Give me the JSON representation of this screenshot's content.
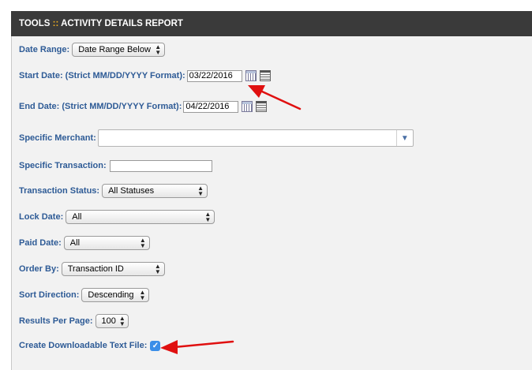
{
  "header": {
    "tools": "TOOLS",
    "sep": "::",
    "title": "ACTIVITY DETAILS REPORT"
  },
  "form": {
    "date_range": {
      "label": "Date Range:",
      "value": "Date Range Below"
    },
    "start_date": {
      "label": "Start Date: (Strict MM/DD/YYYY Format):",
      "value": "03/22/2016"
    },
    "end_date": {
      "label": "End Date: (Strict MM/DD/YYYY Format):",
      "value": "04/22/2016"
    },
    "specific_merchant": {
      "label": "Specific Merchant:",
      "value": ""
    },
    "specific_transaction": {
      "label": "Specific Transaction:",
      "value": ""
    },
    "transaction_status": {
      "label": "Transaction Status:",
      "value": "All Statuses"
    },
    "lock_date": {
      "label": "Lock Date:",
      "value": "All"
    },
    "paid_date": {
      "label": "Paid Date:",
      "value": "All"
    },
    "order_by": {
      "label": "Order By:",
      "value": "Transaction ID"
    },
    "sort_direction": {
      "label": "Sort Direction:",
      "value": "Descending"
    },
    "results_per_page": {
      "label": "Results Per Page:",
      "value": "100"
    },
    "downloadable": {
      "label": "Create Downloadable Text File:",
      "checked": true
    }
  },
  "colors": {
    "header_bg": "#3a3a3a",
    "label": "#2e5b96",
    "annotation_arrow": "#e01010",
    "checkbox": "#3b8ee8"
  },
  "icons": {
    "calendar": "calendar-icon",
    "clear": "calendar-clear-icon",
    "dropdown": "chevron-down-icon",
    "check": "check-icon"
  }
}
